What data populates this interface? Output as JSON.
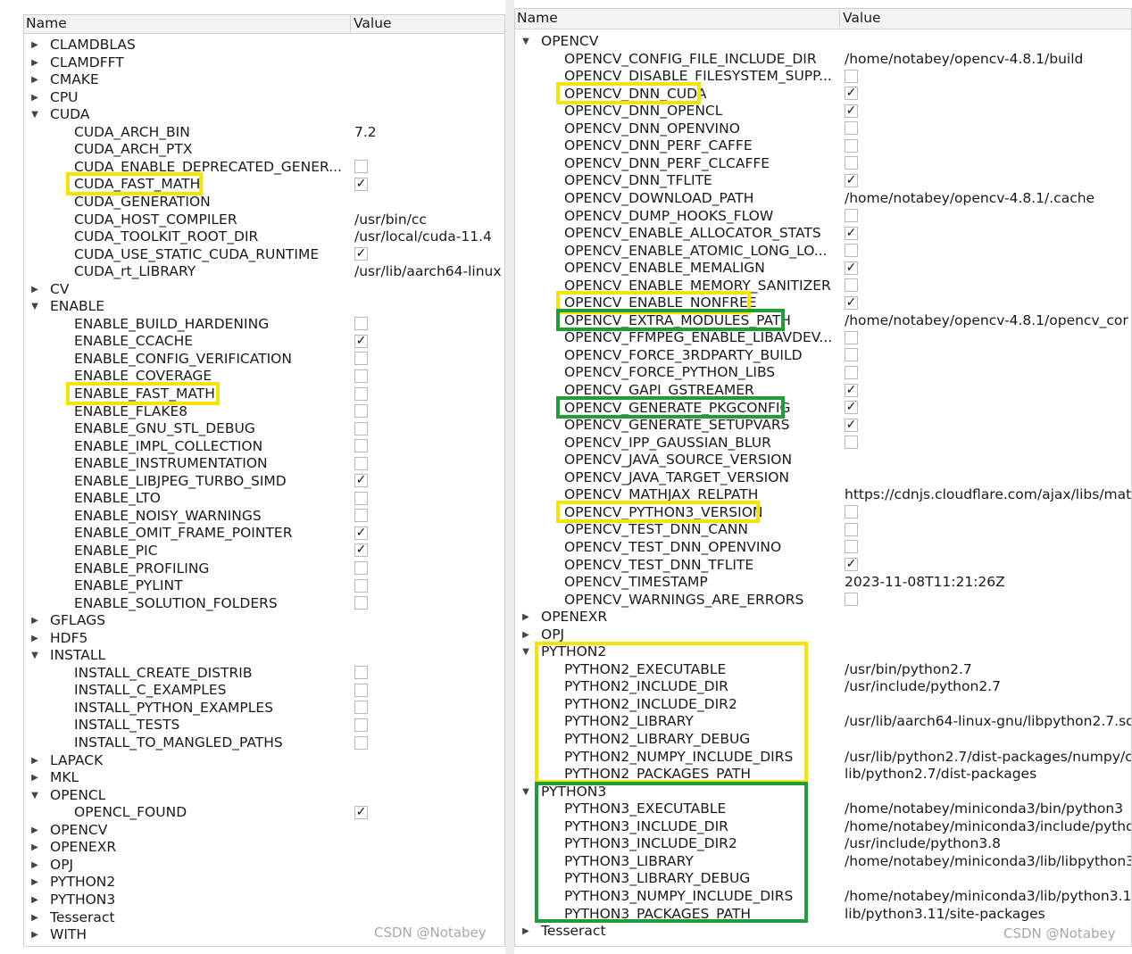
{
  "colors": {
    "yellow": "#f5e400",
    "green": "#1f9d3a"
  },
  "left": {
    "header": {
      "name": "Name",
      "value": "Value"
    },
    "watermark": "CSDN @Notabey",
    "rows": [
      {
        "level": 0,
        "expander": "collapsed",
        "name": "CLAMDBLAS"
      },
      {
        "level": 0,
        "expander": "collapsed",
        "name": "CLAMDFFT"
      },
      {
        "level": 0,
        "expander": "collapsed",
        "name": "CMAKE"
      },
      {
        "level": 0,
        "expander": "collapsed",
        "name": "CPU"
      },
      {
        "level": 0,
        "expander": "expanded",
        "name": "CUDA"
      },
      {
        "level": 1,
        "name": "CUDA_ARCH_BIN",
        "value": "7.2"
      },
      {
        "level": 1,
        "name": "CUDA_ARCH_PTX"
      },
      {
        "level": 1,
        "name": "CUDA_ENABLE_DEPRECATED_GENER...",
        "checkbox": false
      },
      {
        "level": 1,
        "name": "CUDA_FAST_MATH",
        "checkbox": true,
        "highlight": "yellow"
      },
      {
        "level": 1,
        "name": "CUDA_GENERATION"
      },
      {
        "level": 1,
        "name": "CUDA_HOST_COMPILER",
        "value": "/usr/bin/cc"
      },
      {
        "level": 1,
        "name": "CUDA_TOOLKIT_ROOT_DIR",
        "value": "/usr/local/cuda-11.4"
      },
      {
        "level": 1,
        "name": "CUDA_USE_STATIC_CUDA_RUNTIME",
        "checkbox": true
      },
      {
        "level": 1,
        "name": "CUDA_rt_LIBRARY",
        "value": "/usr/lib/aarch64-linux"
      },
      {
        "level": 0,
        "expander": "collapsed",
        "name": "CV"
      },
      {
        "level": 0,
        "expander": "expanded",
        "name": "ENABLE"
      },
      {
        "level": 1,
        "name": "ENABLE_BUILD_HARDENING",
        "checkbox": false
      },
      {
        "level": 1,
        "name": "ENABLE_CCACHE",
        "checkbox": true
      },
      {
        "level": 1,
        "name": "ENABLE_CONFIG_VERIFICATION",
        "checkbox": false
      },
      {
        "level": 1,
        "name": "ENABLE_COVERAGE",
        "checkbox": false
      },
      {
        "level": 1,
        "name": "ENABLE_FAST_MATH",
        "checkbox": false,
        "highlight": "yellow"
      },
      {
        "level": 1,
        "name": "ENABLE_FLAKE8",
        "checkbox": false
      },
      {
        "level": 1,
        "name": "ENABLE_GNU_STL_DEBUG",
        "checkbox": false
      },
      {
        "level": 1,
        "name": "ENABLE_IMPL_COLLECTION",
        "checkbox": false
      },
      {
        "level": 1,
        "name": "ENABLE_INSTRUMENTATION",
        "checkbox": false
      },
      {
        "level": 1,
        "name": "ENABLE_LIBJPEG_TURBO_SIMD",
        "checkbox": true
      },
      {
        "level": 1,
        "name": "ENABLE_LTO",
        "checkbox": false
      },
      {
        "level": 1,
        "name": "ENABLE_NOISY_WARNINGS",
        "checkbox": false
      },
      {
        "level": 1,
        "name": "ENABLE_OMIT_FRAME_POINTER",
        "checkbox": true
      },
      {
        "level": 1,
        "name": "ENABLE_PIC",
        "checkbox": true
      },
      {
        "level": 1,
        "name": "ENABLE_PROFILING",
        "checkbox": false
      },
      {
        "level": 1,
        "name": "ENABLE_PYLINT",
        "checkbox": false
      },
      {
        "level": 1,
        "name": "ENABLE_SOLUTION_FOLDERS",
        "checkbox": false
      },
      {
        "level": 0,
        "expander": "collapsed",
        "name": "GFLAGS"
      },
      {
        "level": 0,
        "expander": "collapsed",
        "name": "HDF5"
      },
      {
        "level": 0,
        "expander": "expanded",
        "name": "INSTALL"
      },
      {
        "level": 1,
        "name": "INSTALL_CREATE_DISTRIB",
        "checkbox": false
      },
      {
        "level": 1,
        "name": "INSTALL_C_EXAMPLES",
        "checkbox": false
      },
      {
        "level": 1,
        "name": "INSTALL_PYTHON_EXAMPLES",
        "checkbox": false
      },
      {
        "level": 1,
        "name": "INSTALL_TESTS",
        "checkbox": false
      },
      {
        "level": 1,
        "name": "INSTALL_TO_MANGLED_PATHS",
        "checkbox": false
      },
      {
        "level": 0,
        "expander": "collapsed",
        "name": "LAPACK"
      },
      {
        "level": 0,
        "expander": "collapsed",
        "name": "MKL"
      },
      {
        "level": 0,
        "expander": "expanded",
        "name": "OPENCL"
      },
      {
        "level": 1,
        "name": "OPENCL_FOUND",
        "checkbox": true
      },
      {
        "level": 0,
        "expander": "collapsed",
        "name": "OPENCV"
      },
      {
        "level": 0,
        "expander": "collapsed",
        "name": "OPENEXR"
      },
      {
        "level": 0,
        "expander": "collapsed",
        "name": "OPJ"
      },
      {
        "level": 0,
        "expander": "collapsed",
        "name": "PYTHON2"
      },
      {
        "level": 0,
        "expander": "collapsed",
        "name": "PYTHON3"
      },
      {
        "level": 0,
        "expander": "collapsed",
        "name": "Tesseract"
      },
      {
        "level": 0,
        "expander": "collapsed",
        "name": "WITH"
      }
    ]
  },
  "right": {
    "header": {
      "name": "Name",
      "value": "Value"
    },
    "watermark": "CSDN @Notabey",
    "rows": [
      {
        "level": 0,
        "expander": "expanded",
        "name": "OPENCV"
      },
      {
        "level": 1,
        "name": "OPENCV_CONFIG_FILE_INCLUDE_DIR",
        "value": "/home/notabey/opencv-4.8.1/build"
      },
      {
        "level": 1,
        "name": "OPENCV_DISABLE_FILESYSTEM_SUPP...",
        "checkbox": false
      },
      {
        "level": 1,
        "name": "OPENCV_DNN_CUDA",
        "checkbox": true,
        "highlight": "yellow"
      },
      {
        "level": 1,
        "name": "OPENCV_DNN_OPENCL",
        "checkbox": true
      },
      {
        "level": 1,
        "name": "OPENCV_DNN_OPENVINO",
        "checkbox": false
      },
      {
        "level": 1,
        "name": "OPENCV_DNN_PERF_CAFFE",
        "checkbox": false
      },
      {
        "level": 1,
        "name": "OPENCV_DNN_PERF_CLCAFFE",
        "checkbox": false
      },
      {
        "level": 1,
        "name": "OPENCV_DNN_TFLITE",
        "checkbox": true
      },
      {
        "level": 1,
        "name": "OPENCV_DOWNLOAD_PATH",
        "value": "/home/notabey/opencv-4.8.1/.cache"
      },
      {
        "level": 1,
        "name": "OPENCV_DUMP_HOOKS_FLOW",
        "checkbox": false
      },
      {
        "level": 1,
        "name": "OPENCV_ENABLE_ALLOCATOR_STATS",
        "checkbox": true
      },
      {
        "level": 1,
        "name": "OPENCV_ENABLE_ATOMIC_LONG_LO...",
        "checkbox": false
      },
      {
        "level": 1,
        "name": "OPENCV_ENABLE_MEMALIGN",
        "checkbox": true
      },
      {
        "level": 1,
        "name": "OPENCV_ENABLE_MEMORY_SANITIZER",
        "checkbox": false
      },
      {
        "level": 1,
        "name": "OPENCV_ENABLE_NONFREE",
        "checkbox": true,
        "highlight": "yellow"
      },
      {
        "level": 1,
        "name": "OPENCV_EXTRA_MODULES_PATH",
        "value": "/home/notabey/opencv-4.8.1/opencv_cor",
        "highlight": "green"
      },
      {
        "level": 1,
        "name": "OPENCV_FFMPEG_ENABLE_LIBAVDEV...",
        "checkbox": false
      },
      {
        "level": 1,
        "name": "OPENCV_FORCE_3RDPARTY_BUILD",
        "checkbox": false
      },
      {
        "level": 1,
        "name": "OPENCV_FORCE_PYTHON_LIBS",
        "checkbox": false
      },
      {
        "level": 1,
        "name": "OPENCV_GAPI_GSTREAMER",
        "checkbox": true
      },
      {
        "level": 1,
        "name": "OPENCV_GENERATE_PKGCONFIG",
        "checkbox": true,
        "highlight": "green"
      },
      {
        "level": 1,
        "name": "OPENCV_GENERATE_SETUPVARS",
        "checkbox": true
      },
      {
        "level": 1,
        "name": "OPENCV_IPP_GAUSSIAN_BLUR",
        "checkbox": false
      },
      {
        "level": 1,
        "name": "OPENCV_JAVA_SOURCE_VERSION"
      },
      {
        "level": 1,
        "name": "OPENCV_JAVA_TARGET_VERSION"
      },
      {
        "level": 1,
        "name": "OPENCV_MATHJAX_RELPATH",
        "value": "https://cdnjs.cloudflare.com/ajax/libs/mat"
      },
      {
        "level": 1,
        "name": "OPENCV_PYTHON3_VERSION",
        "checkbox": false,
        "highlight": "yellow"
      },
      {
        "level": 1,
        "name": "OPENCV_TEST_DNN_CANN",
        "checkbox": false
      },
      {
        "level": 1,
        "name": "OPENCV_TEST_DNN_OPENVINO",
        "checkbox": false
      },
      {
        "level": 1,
        "name": "OPENCV_TEST_DNN_TFLITE",
        "checkbox": true
      },
      {
        "level": 1,
        "name": "OPENCV_TIMESTAMP",
        "value": "2023-11-08T11:21:26Z"
      },
      {
        "level": 1,
        "name": "OPENCV_WARNINGS_ARE_ERRORS",
        "checkbox": false
      },
      {
        "level": 0,
        "expander": "collapsed",
        "name": "OPENEXR"
      },
      {
        "level": 0,
        "expander": "collapsed",
        "name": "OPJ"
      },
      {
        "level": 0,
        "expander": "expanded",
        "name": "PYTHON2"
      },
      {
        "level": 1,
        "name": "PYTHON2_EXECUTABLE",
        "value": "/usr/bin/python2.7"
      },
      {
        "level": 1,
        "name": "PYTHON2_INCLUDE_DIR",
        "value": "/usr/include/python2.7"
      },
      {
        "level": 1,
        "name": "PYTHON2_INCLUDE_DIR2"
      },
      {
        "level": 1,
        "name": "PYTHON2_LIBRARY",
        "value": "/usr/lib/aarch64-linux-gnu/libpython2.7.so"
      },
      {
        "level": 1,
        "name": "PYTHON2_LIBRARY_DEBUG"
      },
      {
        "level": 1,
        "name": "PYTHON2_NUMPY_INCLUDE_DIRS",
        "value": "/usr/lib/python2.7/dist-packages/numpy/c"
      },
      {
        "level": 1,
        "name": "PYTHON2_PACKAGES_PATH",
        "value": "lib/python2.7/dist-packages"
      },
      {
        "level": 0,
        "expander": "expanded",
        "name": "PYTHON3"
      },
      {
        "level": 1,
        "name": "PYTHON3_EXECUTABLE",
        "value": "/home/notabey/miniconda3/bin/python3"
      },
      {
        "level": 1,
        "name": "PYTHON3_INCLUDE_DIR",
        "value": "/home/notabey/miniconda3/include/pytho"
      },
      {
        "level": 1,
        "name": "PYTHON3_INCLUDE_DIR2",
        "value": "/usr/include/python3.8"
      },
      {
        "level": 1,
        "name": "PYTHON3_LIBRARY",
        "value": "/home/notabey/miniconda3/lib/libpython3"
      },
      {
        "level": 1,
        "name": "PYTHON3_LIBRARY_DEBUG"
      },
      {
        "level": 1,
        "name": "PYTHON3_NUMPY_INCLUDE_DIRS",
        "value": "/home/notabey/miniconda3/lib/python3.1"
      },
      {
        "level": 1,
        "name": "PYTHON3_PACKAGES_PATH",
        "value": "lib/python3.11/site-packages"
      },
      {
        "level": 0,
        "expander": "collapsed",
        "name": "Tesseract"
      }
    ],
    "box_highlights": [
      {
        "from_row": 35,
        "to_row": 42,
        "color": "yellow"
      },
      {
        "from_row": 43,
        "to_row": 50,
        "color": "green"
      }
    ]
  }
}
